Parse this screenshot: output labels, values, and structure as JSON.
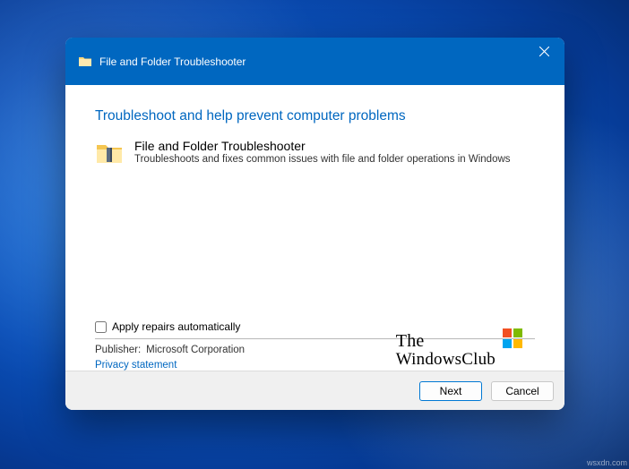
{
  "window": {
    "title": "File and Folder Troubleshooter"
  },
  "content": {
    "heading": "Troubleshoot and help prevent computer problems",
    "item_title": "File and Folder Troubleshooter",
    "item_description": "Troubleshoots and fixes common issues with file and folder operations in Windows",
    "apply_repairs_label": "Apply repairs automatically",
    "apply_repairs_checked": false,
    "publisher_label": "Publisher:",
    "publisher_value": "Microsoft Corporation",
    "privacy_link": "Privacy statement"
  },
  "buttons": {
    "next": "Next",
    "cancel": "Cancel"
  },
  "watermark": {
    "line1": "The",
    "line2": "WindowsClub"
  },
  "source": "wsxdn.com"
}
